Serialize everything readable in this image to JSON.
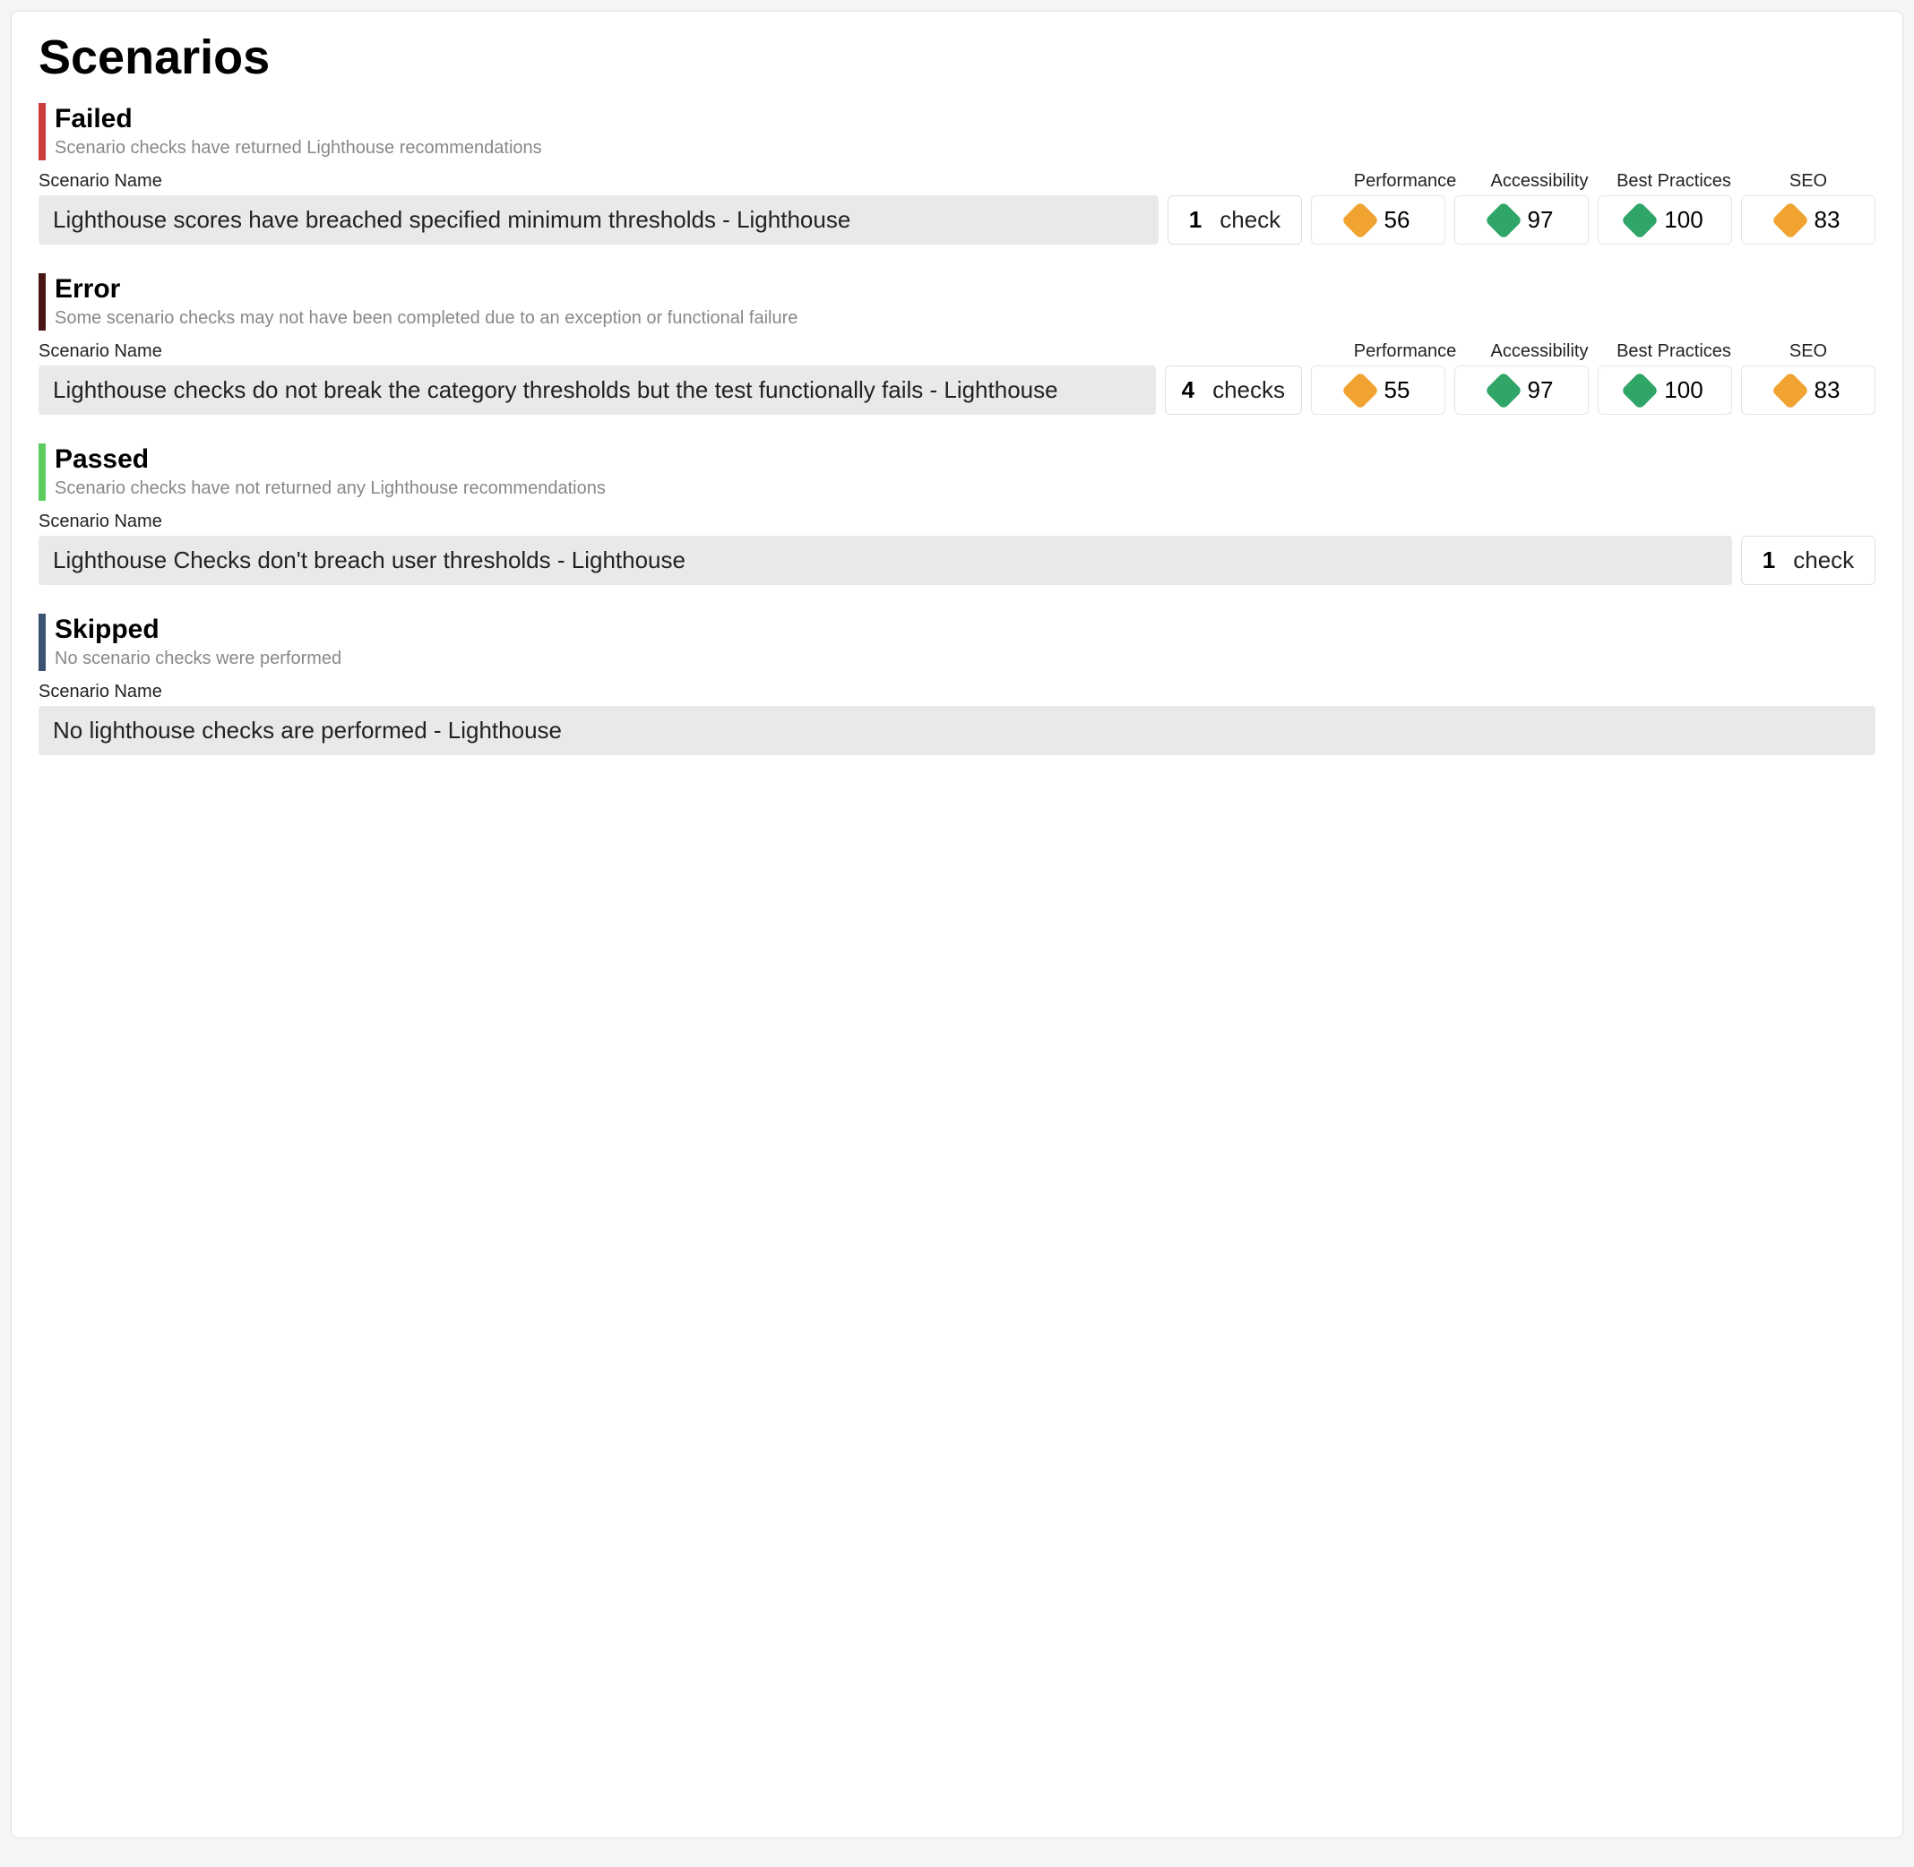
{
  "page_title": "Scenarios",
  "columns": {
    "name": "Scenario Name",
    "performance": "Performance",
    "accessibility": "Accessibility",
    "best_practices": "Best Practices",
    "seo": "SEO"
  },
  "sections": [
    {
      "key": "failed",
      "title": "Failed",
      "subtitle": "Scenario checks have returned Lighthouse recommendations",
      "bar_class": "bar-failed",
      "show_metrics": true,
      "scenario": {
        "name": "Lighthouse scores have breached specified minimum thresholds - Lighthouse",
        "check_count": "1",
        "check_label": "check",
        "metrics": [
          {
            "key": "performance",
            "value": "56",
            "color": "orange"
          },
          {
            "key": "accessibility",
            "value": "97",
            "color": "green"
          },
          {
            "key": "best_practices",
            "value": "100",
            "color": "green"
          },
          {
            "key": "seo",
            "value": "83",
            "color": "orange"
          }
        ]
      }
    },
    {
      "key": "error",
      "title": "Error",
      "subtitle": "Some scenario checks may not have been completed due to an exception or functional failure",
      "bar_class": "bar-error",
      "show_metrics": true,
      "scenario": {
        "name": "Lighthouse checks do not break the category thresholds but the test functionally fails - Lighthouse",
        "check_count": "4",
        "check_label": "checks",
        "metrics": [
          {
            "key": "performance",
            "value": "55",
            "color": "orange"
          },
          {
            "key": "accessibility",
            "value": "97",
            "color": "green"
          },
          {
            "key": "best_practices",
            "value": "100",
            "color": "green"
          },
          {
            "key": "seo",
            "value": "83",
            "color": "orange"
          }
        ]
      }
    },
    {
      "key": "passed",
      "title": "Passed",
      "subtitle": "Scenario checks have not returned any Lighthouse recommendations",
      "bar_class": "bar-passed",
      "show_metrics": false,
      "scenario": {
        "name": "Lighthouse Checks don't breach user thresholds - Lighthouse",
        "check_count": "1",
        "check_label": "check",
        "metrics": []
      }
    },
    {
      "key": "skipped",
      "title": "Skipped",
      "subtitle": "No scenario checks were performed",
      "bar_class": "bar-skipped",
      "show_metrics": false,
      "scenario": {
        "name": "No lighthouse checks are performed - Lighthouse",
        "check_count": null,
        "check_label": null,
        "metrics": []
      }
    }
  ]
}
